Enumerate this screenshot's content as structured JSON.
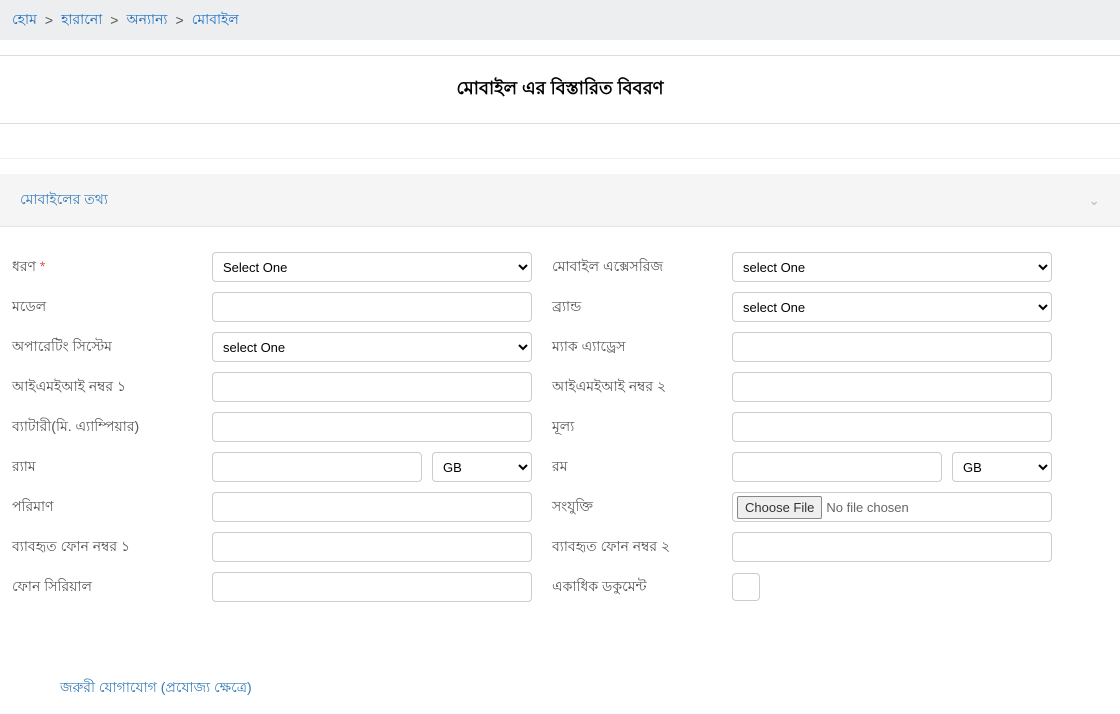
{
  "breadcrumb": {
    "items": [
      {
        "label": "হোম"
      },
      {
        "label": "হারানো"
      },
      {
        "label": "অন্যান্য"
      },
      {
        "label": "মোবাইল"
      }
    ],
    "sep": ">"
  },
  "page": {
    "title": "মোবাইল এর বিস্তারিত বিবরণ"
  },
  "panel": {
    "title": "মোবাইলের তথ্য"
  },
  "common": {
    "select_one_en": "Select One",
    "select_one_lc": "select One",
    "gb": "GB",
    "choose_file": "Choose File",
    "no_file": "No file chosen"
  },
  "form": {
    "left": {
      "type": "ধরণ",
      "model": "মডেল",
      "os": "অপারেটিং সিস্টেম",
      "imei1": "আইএমইআই নম্বর ১",
      "battery": "ব্যাটারী(মি. এ্যাম্পিয়ার)",
      "ram": "র‍্যাম",
      "quantity": "পরিমাণ",
      "used_phone1": "ব্যাবহৃত ফোন নম্বর ১",
      "phone_serial": "ফোন সিরিয়াল"
    },
    "right": {
      "accessories": "মোবাইল এক্সেসরিজ",
      "brand": "ব্র্যান্ড",
      "mac": "ম্যাক এ্যাড্রেস",
      "imei2": "আইএমইআই নম্বর ২",
      "price": "মূল্য",
      "rom": "রম",
      "attachment": "সংযুক্তি",
      "used_phone2": "ব্যাবহৃত ফোন নম্বর ২",
      "multi_doc": "একাধিক ডকুমেন্ট"
    }
  },
  "section2": {
    "title": "জরুরী যোগাযোগ (প্রযোজ্য ক্ষেত্রে)"
  }
}
